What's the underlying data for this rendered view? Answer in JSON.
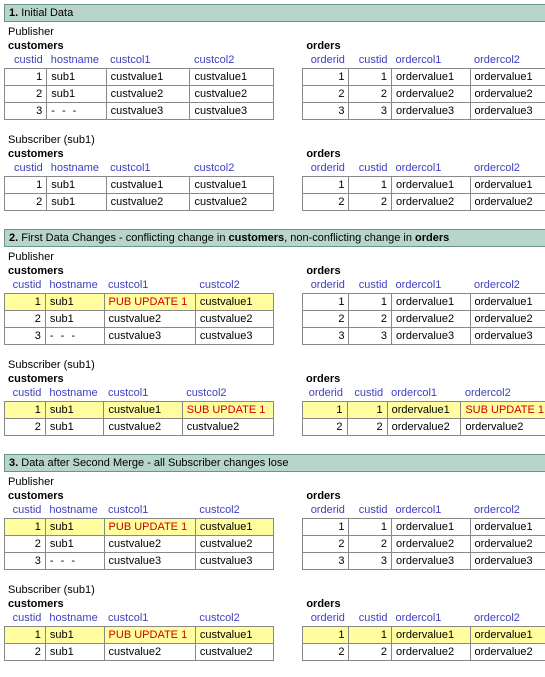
{
  "sections": [
    {
      "num": "1.",
      "title": "Initial Data",
      "publisher": "Publisher",
      "subscriber": "Subscriber (sub1)",
      "customers_title": "customers",
      "orders_title": "orders",
      "cust_headers": [
        "custid",
        "hostname",
        "custcol1",
        "custcol2"
      ],
      "ord_headers": [
        "orderid",
        "custid",
        "ordercol1",
        "ordercol2"
      ],
      "pub_customers": [
        {
          "id": "1",
          "host": "sub1",
          "c1": "custvalue1",
          "c2": "custvalue1"
        },
        {
          "id": "2",
          "host": "sub1",
          "c1": "custvalue2",
          "c2": "custvalue2"
        },
        {
          "id": "3",
          "host": "- - -",
          "c1": "custvalue3",
          "c2": "custvalue3"
        }
      ],
      "pub_orders": [
        {
          "oid": "1",
          "cid": "1",
          "o1": "ordervalue1",
          "o2": "ordervalue1"
        },
        {
          "oid": "2",
          "cid": "2",
          "o1": "ordervalue2",
          "o2": "ordervalue2"
        },
        {
          "oid": "3",
          "cid": "3",
          "o1": "ordervalue3",
          "o2": "ordervalue3"
        }
      ],
      "sub_customers": [
        {
          "id": "1",
          "host": "sub1",
          "c1": "custvalue1",
          "c2": "custvalue1"
        },
        {
          "id": "2",
          "host": "sub1",
          "c1": "custvalue2",
          "c2": "custvalue2"
        }
      ],
      "sub_orders": [
        {
          "oid": "1",
          "cid": "1",
          "o1": "ordervalue1",
          "o2": "ordervalue1"
        },
        {
          "oid": "2",
          "cid": "2",
          "o1": "ordervalue2",
          "o2": "ordervalue2"
        }
      ]
    },
    {
      "num": "2.",
      "title_html": "First Data Changes - conflicting change in <b>customers</b>, non-conflicting change in <b>orders</b>",
      "publisher": "Publisher",
      "subscriber": "Subscriber (sub1)",
      "customers_title": "customers",
      "orders_title": "orders",
      "cust_headers": [
        "custid",
        "hostname",
        "custcol1",
        "custcol2"
      ],
      "ord_headers": [
        "orderid",
        "custid",
        "ordercol1",
        "ordercol2"
      ],
      "pub_customers": [
        {
          "id": "1",
          "host": "sub1",
          "c1": "PUB UPDATE 1",
          "c2": "custvalue1",
          "hl": true,
          "c1_changed": true
        },
        {
          "id": "2",
          "host": "sub1",
          "c1": "custvalue2",
          "c2": "custvalue2"
        },
        {
          "id": "3",
          "host": "- - -",
          "c1": "custvalue3",
          "c2": "custvalue3"
        }
      ],
      "pub_orders": [
        {
          "oid": "1",
          "cid": "1",
          "o1": "ordervalue1",
          "o2": "ordervalue1"
        },
        {
          "oid": "2",
          "cid": "2",
          "o1": "ordervalue2",
          "o2": "ordervalue2"
        },
        {
          "oid": "3",
          "cid": "3",
          "o1": "ordervalue3",
          "o2": "ordervalue3"
        }
      ],
      "sub_customers": [
        {
          "id": "1",
          "host": "sub1",
          "c1": "custvalue1",
          "c2": "SUB UPDATE 1",
          "hl": true,
          "c2_changed": true
        },
        {
          "id": "2",
          "host": "sub1",
          "c1": "custvalue2",
          "c2": "custvalue2"
        }
      ],
      "sub_orders": [
        {
          "oid": "1",
          "cid": "1",
          "o1": "ordervalue1",
          "o2": "SUB UPDATE 1",
          "hl": true,
          "o2_changed": true
        },
        {
          "oid": "2",
          "cid": "2",
          "o1": "ordervalue2",
          "o2": "ordervalue2"
        }
      ]
    },
    {
      "num": "3.",
      "title": "Data after Second Merge - all Subscriber changes lose",
      "publisher": "Publisher",
      "subscriber": "Subscriber (sub1)",
      "customers_title": "customers",
      "orders_title": "orders",
      "cust_headers": [
        "custid",
        "hostname",
        "custcol1",
        "custcol2"
      ],
      "ord_headers": [
        "orderid",
        "custid",
        "ordercol1",
        "ordercol2"
      ],
      "pub_customers": [
        {
          "id": "1",
          "host": "sub1",
          "c1": "PUB UPDATE 1",
          "c2": "custvalue1",
          "hl": true,
          "c1_changed": true
        },
        {
          "id": "2",
          "host": "sub1",
          "c1": "custvalue2",
          "c2": "custvalue2"
        },
        {
          "id": "3",
          "host": "- - -",
          "c1": "custvalue3",
          "c2": "custvalue3"
        }
      ],
      "pub_orders": [
        {
          "oid": "1",
          "cid": "1",
          "o1": "ordervalue1",
          "o2": "ordervalue1"
        },
        {
          "oid": "2",
          "cid": "2",
          "o1": "ordervalue2",
          "o2": "ordervalue2"
        },
        {
          "oid": "3",
          "cid": "3",
          "o1": "ordervalue3",
          "o2": "ordervalue3"
        }
      ],
      "sub_customers": [
        {
          "id": "1",
          "host": "sub1",
          "c1": "PUB UPDATE 1",
          "c2": "custvalue1",
          "hl": true,
          "c1_changed": true
        },
        {
          "id": "2",
          "host": "sub1",
          "c1": "custvalue2",
          "c2": "custvalue2"
        }
      ],
      "sub_orders": [
        {
          "oid": "1",
          "cid": "1",
          "o1": "ordervalue1",
          "o2": "ordervalue1",
          "hl": true
        },
        {
          "oid": "2",
          "cid": "2",
          "o1": "ordervalue2",
          "o2": "ordervalue2"
        }
      ]
    }
  ]
}
